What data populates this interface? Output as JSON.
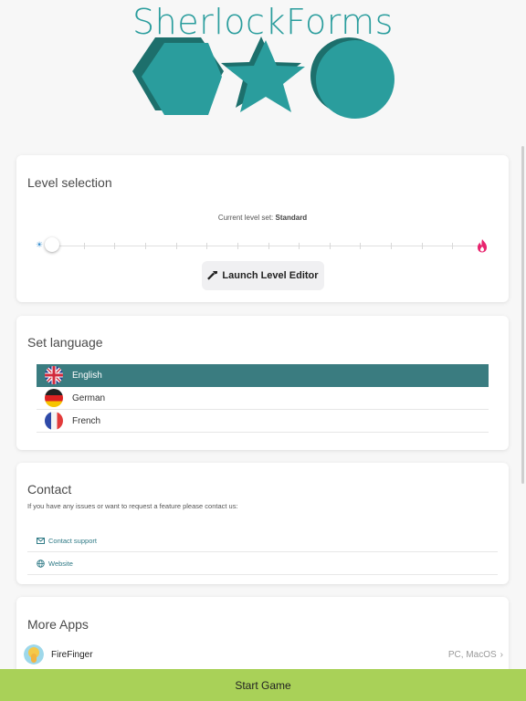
{
  "app": {
    "title": "SherlockForms",
    "logo_color": "#2a9d9d",
    "logo_shadow_color": "#1d6f6c",
    "logo_shapes": [
      "hexagon",
      "star",
      "circle"
    ]
  },
  "level_selection": {
    "title": "Level selection",
    "status_prefix": "Current level set: ",
    "status_value": "Standard",
    "slider_value": 0,
    "slider_steps": 14,
    "left_icon": "sun-icon",
    "right_icon": "flame-icon",
    "editor_icon": "hammer-icon",
    "editor_button_label": "Launch Level Editor"
  },
  "language": {
    "title": "Set language",
    "selected_color": "#3a7c80",
    "items": [
      {
        "label": "English",
        "flag": "uk-flag-icon",
        "selected": true
      },
      {
        "label": "German",
        "flag": "germany-flag-icon",
        "selected": false
      },
      {
        "label": "French",
        "flag": "france-flag-icon",
        "selected": false
      }
    ]
  },
  "contact": {
    "title": "Contact",
    "subtitle": "If you have any issues or want to request a feature please contact us:",
    "items": [
      {
        "label": "Contact support",
        "icon": "mail-icon"
      },
      {
        "label": "Website",
        "icon": "globe-icon"
      }
    ],
    "link_color": "#2f7a86"
  },
  "more_apps": {
    "title": "More Apps",
    "items": [
      {
        "name": "FireFinger",
        "platforms": "PC, MacOS",
        "icon": "firefinger-app-icon"
      }
    ]
  },
  "start_button": {
    "label": "Start Game",
    "color": "#a9d158"
  }
}
